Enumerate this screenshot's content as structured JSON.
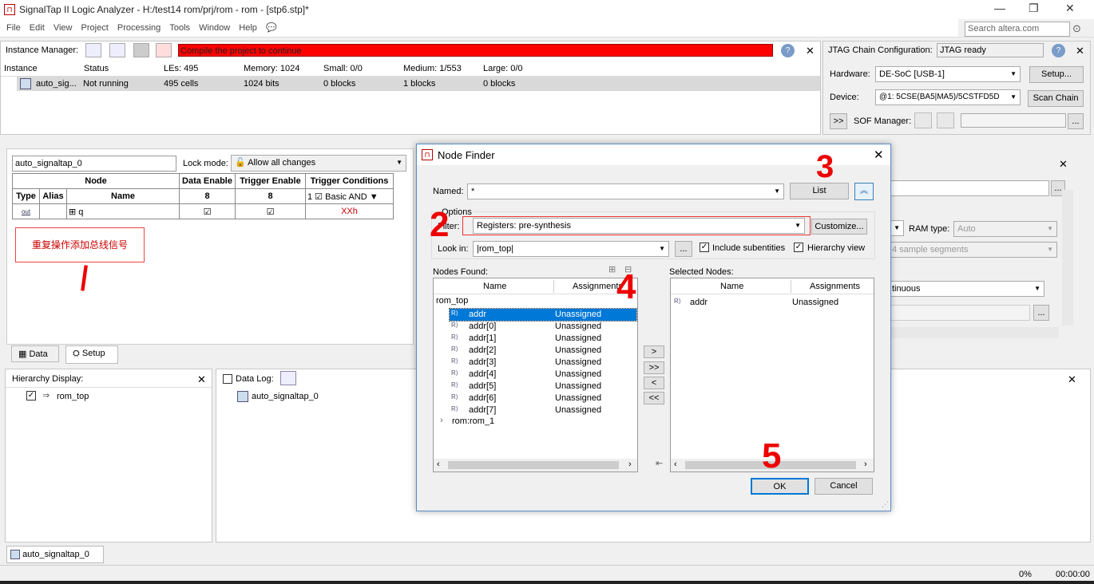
{
  "window": {
    "title": "SignalTap II Logic Analyzer - H:/test14 rom/prj/rom - rom - [stp6.stp]*",
    "search_placeholder": "Search altera.com"
  },
  "menu": [
    "File",
    "Edit",
    "View",
    "Project",
    "Processing",
    "Tools",
    "Window",
    "Help"
  ],
  "instance_manager": {
    "label": "Instance Manager:",
    "status_message": "Compile the project to continue",
    "headers": [
      "Instance",
      "Status",
      "LEs: 495",
      "Memory: 1024",
      "Small: 0/0",
      "Medium: 1/553",
      "Large: 0/0"
    ],
    "row": [
      "auto_sig...",
      "Not running",
      "495 cells",
      "1024 bits",
      "0 blocks",
      "1 blocks",
      "0 blocks"
    ]
  },
  "jtag": {
    "label": "JTAG Chain Configuration:",
    "status": "JTAG ready",
    "hardware_label": "Hardware:",
    "hardware": "DE-SoC [USB-1]",
    "setup": "Setup...",
    "device_label": "Device:",
    "device": "@1: 5CSE(BA5|MA5)/5CSTFD5D",
    "scan_chain": "Scan Chain",
    "expand": ">>",
    "sof_label": "SOF Manager:",
    "browse": "..."
  },
  "setup_pane": {
    "instance": "auto_signaltap_0",
    "lock_mode_label": "Lock mode:",
    "lock_mode": "Allow all changes",
    "col_node": "Node",
    "col_data_enable": "Data Enable",
    "col_trigger_enable": "Trigger Enable",
    "col_trigger_conditions": "Trigger Conditions",
    "col_type": "Type",
    "col_alias": "Alias",
    "col_name": "Name",
    "data_enable_count": "8",
    "trigger_enable_count": "8",
    "trigger_num": "1",
    "trigger_mode": "Basic AND",
    "row_type": "out",
    "row_name": "q",
    "row_trigger": "XXh",
    "annotation": "重复操作添加总线信号",
    "annotation_num": "1"
  },
  "tabs": {
    "data": "Data",
    "setup": "Setup"
  },
  "hierarchy": {
    "label": "Hierarchy Display:",
    "item": "rom_top"
  },
  "datalog": {
    "label": "Data Log:",
    "item": "auto_signaltap_0"
  },
  "right_settings": {
    "ram_type_label": "RAM type:",
    "ram_type": "Auto",
    "segments": "4 sample segments",
    "continuous": "tinuous",
    "browse": "..."
  },
  "bottom": {
    "tab": "auto_signaltap_0",
    "progress": "0%",
    "time": "00:00:00"
  },
  "dialog": {
    "title": "Node Finder",
    "named_label": "Named:",
    "named_value": "*",
    "list_button": "List",
    "options_label": "Options",
    "filter_label": "Filter:",
    "filter_value": "Registers: pre-synthesis",
    "customize": "Customize...",
    "lookin_label": "Look in:",
    "lookin_value": "|rom_top|",
    "browse": "...",
    "include_subentities": "Include subentities",
    "hierarchy_view": "Hierarchy view",
    "nodes_found_label": "Nodes Found:",
    "selected_nodes_label": "Selected Nodes:",
    "col_name": "Name",
    "col_assignments": "Assignments",
    "root": "rom_top",
    "nodes": [
      {
        "name": "addr",
        "assign": "Unassigned"
      },
      {
        "name": "addr[0]",
        "assign": "Unassigned"
      },
      {
        "name": "addr[1]",
        "assign": "Unassigned"
      },
      {
        "name": "addr[2]",
        "assign": "Unassigned"
      },
      {
        "name": "addr[3]",
        "assign": "Unassigned"
      },
      {
        "name": "addr[4]",
        "assign": "Unassigned"
      },
      {
        "name": "addr[5]",
        "assign": "Unassigned"
      },
      {
        "name": "addr[6]",
        "assign": "Unassigned"
      },
      {
        "name": "addr[7]",
        "assign": "Unassigned"
      }
    ],
    "sub_entity": "rom:rom_1",
    "selected": [
      {
        "name": "addr",
        "assign": "Unassigned"
      }
    ],
    "move_one": ">",
    "move_all": ">>",
    "remove_one": "<",
    "remove_all": "<<",
    "ok": "OK",
    "cancel": "Cancel"
  },
  "annotations": [
    "2",
    "3",
    "4",
    "5"
  ]
}
